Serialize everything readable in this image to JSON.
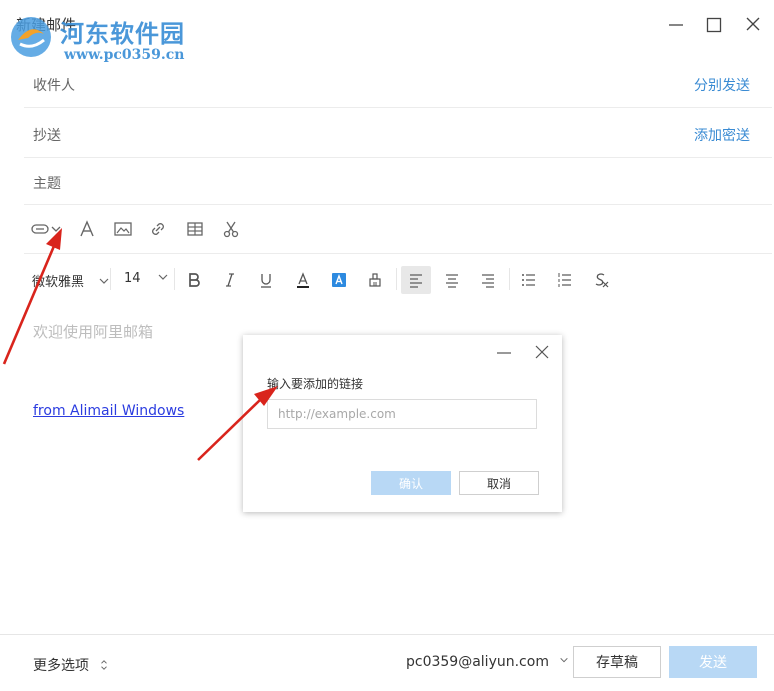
{
  "window": {
    "title": "新建邮件",
    "minimize_icon": "minimize-icon",
    "maximize_icon": "maximize-icon",
    "close_icon": "close-icon"
  },
  "watermark": {
    "name": "河东软件园",
    "url": "www.pc0359.cn"
  },
  "fields": {
    "to_label": "收件人",
    "to_action": "分别发送",
    "cc_label": "抄送",
    "cc_action": "添加密送",
    "subject_label": "主题"
  },
  "toolbar_insert": {
    "icons": [
      "attachment-icon",
      "chevron-down-icon",
      "font-icon",
      "image-icon",
      "link-icon",
      "table-icon",
      "scissors-icon"
    ]
  },
  "toolbar_format": {
    "font_family": "微软雅黑",
    "font_size": "14",
    "icons": [
      "bold-icon",
      "italic-icon",
      "underline-icon",
      "font-color-icon",
      "highlight-icon",
      "format-painter-icon",
      "align-left-icon",
      "align-center-icon",
      "align-right-icon",
      "bullet-list-icon",
      "numbered-list-icon",
      "clear-format-icon"
    ]
  },
  "editor": {
    "placeholder": "欢迎使用阿里邮箱",
    "signature_link": "from Alimail Windows"
  },
  "link_dialog": {
    "label": "输入要添加的链接",
    "input_placeholder": "http://example.com",
    "input_value": "",
    "confirm": "确认",
    "cancel": "取消"
  },
  "footer": {
    "more_options": "更多选项",
    "sender": "pc0359@aliyun.com",
    "save_draft": "存草稿",
    "send": "发送"
  },
  "colors": {
    "accent": "#3a8bd3",
    "disabled_button": "#b8d8f5",
    "annotation_arrow": "#d9241c",
    "signature_link": "#2b3ce0"
  }
}
